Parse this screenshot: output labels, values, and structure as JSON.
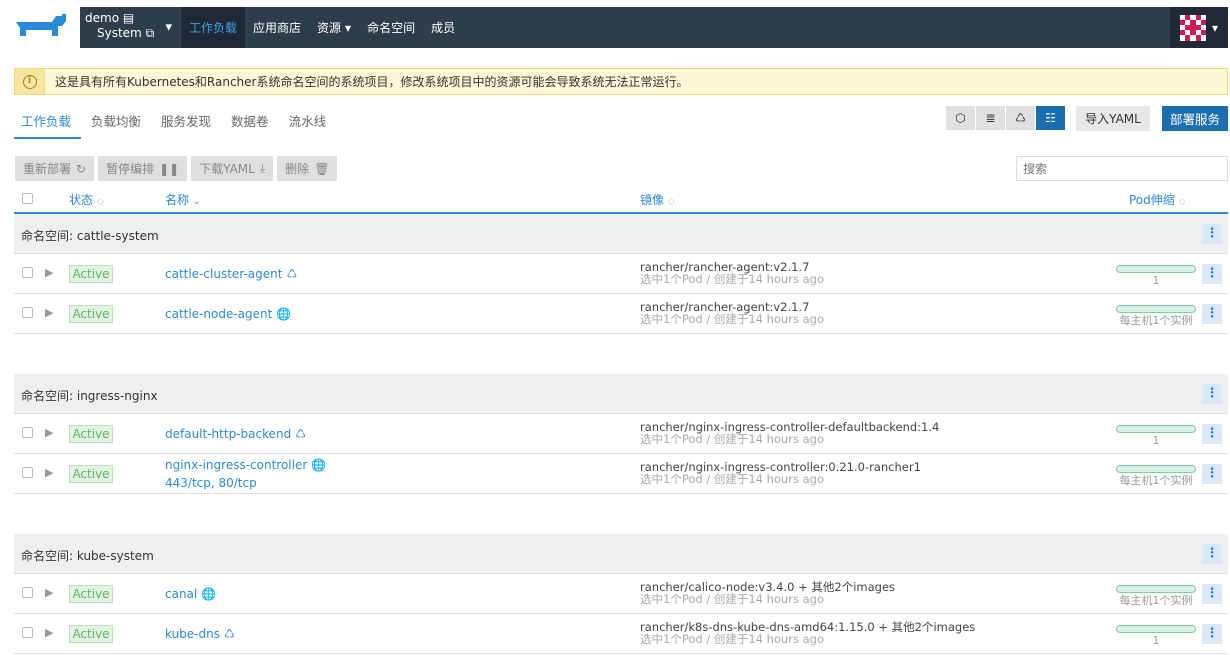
{
  "nav": {
    "project_name": "demo",
    "cluster_name": "System",
    "items": [
      "工作负载",
      "应用商店",
      "资源",
      "命名空间",
      "成员"
    ]
  },
  "banner": {
    "text": "这是具有所有Kubernetes和Rancher系统命名空间的系统项目，修改系统项目中的资源可能会导致系统无法正常运行。"
  },
  "tabs": [
    "工作负载",
    "负载均衡",
    "服务发现",
    "数据卷",
    "流水线"
  ],
  "actions": {
    "import_yaml": "导入YAML",
    "deploy": "部署服务"
  },
  "bulk": {
    "redeploy": "重新部署",
    "pause": "暂停编排",
    "download": "下载YAML",
    "delete": "删除"
  },
  "search": {
    "placeholder": "搜索"
  },
  "columns": {
    "state": "状态",
    "name": "名称",
    "image": "镜像",
    "pod_scale": "Pod伸缩"
  },
  "groups": [
    {
      "label": "命名空间: cattle-system",
      "rows": [
        {
          "state": "Active",
          "name": "cattle-cluster-agent",
          "icon": "scale-icon",
          "ports": "",
          "image": "rancher/rancher-agent:v2.1.7",
          "sub": "选中1个Pod / 创建于14 hours ago",
          "scale": "1",
          "fill": 1.0
        },
        {
          "state": "Active",
          "name": "cattle-node-agent",
          "icon": "globe-icon",
          "ports": "",
          "image": "rancher/rancher-agent:v2.1.7",
          "sub": "选中1个Pod / 创建于14 hours ago",
          "scale": "每主机1个实例",
          "fill": 1.0
        }
      ]
    },
    {
      "label": "命名空间: ingress-nginx",
      "rows": [
        {
          "state": "Active",
          "name": "default-http-backend",
          "icon": "scale-icon",
          "ports": "",
          "image": "rancher/nginx-ingress-controller-defaultbackend:1.4",
          "sub": "选中1个Pod / 创建于14 hours ago",
          "scale": "1",
          "fill": 1.0
        },
        {
          "state": "Active",
          "name": "nginx-ingress-controller",
          "icon": "globe-icon",
          "ports": "443/tcp, 80/tcp",
          "image": "rancher/nginx-ingress-controller:0.21.0-rancher1",
          "sub": "选中1个Pod / 创建于14 hours ago",
          "scale": "每主机1个实例",
          "fill": 1.0
        }
      ]
    },
    {
      "label": "命名空间: kube-system",
      "rows": [
        {
          "state": "Active",
          "name": "canal",
          "icon": "globe-icon",
          "ports": "",
          "image": "rancher/calico-node:v3.4.0 + 其他2个images",
          "sub": "选中1个Pod / 创建于14 hours ago",
          "scale": "每主机1个实例",
          "fill": 1.0
        },
        {
          "state": "Active",
          "name": "kube-dns",
          "icon": "scale-icon",
          "ports": "",
          "image": "rancher/k8s-dns-kube-dns-amd64:1.15.0 + 其他2个images",
          "sub": "选中1个Pod / 创建于14 hours ago",
          "scale": "1",
          "fill": 1.0
        }
      ]
    }
  ],
  "colors": {
    "accent": "#2b8ad7",
    "nav_bg": "#2e3d4c",
    "active_green": "#5cb85c",
    "banner_bg": "#fdf6d4"
  }
}
